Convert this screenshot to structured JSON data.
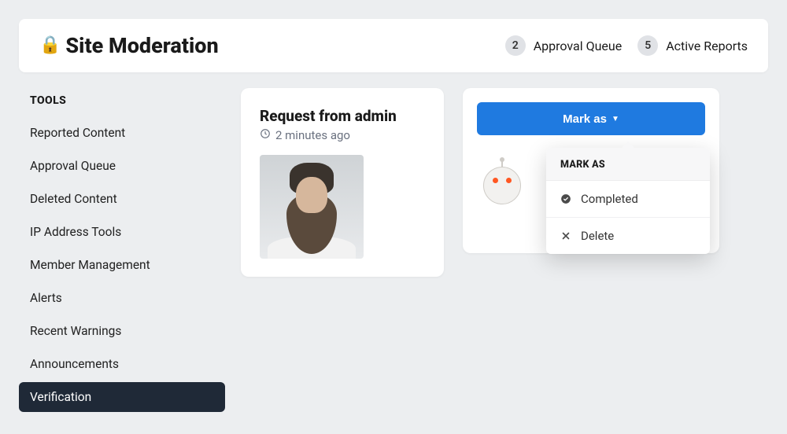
{
  "header": {
    "title": "Site Moderation",
    "approval_count": "2",
    "approval_label": "Approval Queue",
    "reports_count": "5",
    "reports_label": "Active Reports"
  },
  "sidebar": {
    "heading": "TOOLS",
    "items": [
      {
        "label": "Reported Content"
      },
      {
        "label": "Approval Queue"
      },
      {
        "label": "Deleted Content"
      },
      {
        "label": "IP Address Tools"
      },
      {
        "label": "Member Management"
      },
      {
        "label": "Alerts"
      },
      {
        "label": "Recent Warnings"
      },
      {
        "label": "Announcements"
      },
      {
        "label": "Verification"
      }
    ],
    "active_index": 8
  },
  "request": {
    "title": "Request from admin",
    "time": "2 minutes ago"
  },
  "mark_as": {
    "button_label": "Mark as",
    "dropdown_heading": "MARK AS",
    "options": [
      {
        "icon": "check-circle",
        "label": "Completed"
      },
      {
        "icon": "x",
        "label": "Delete"
      }
    ]
  }
}
